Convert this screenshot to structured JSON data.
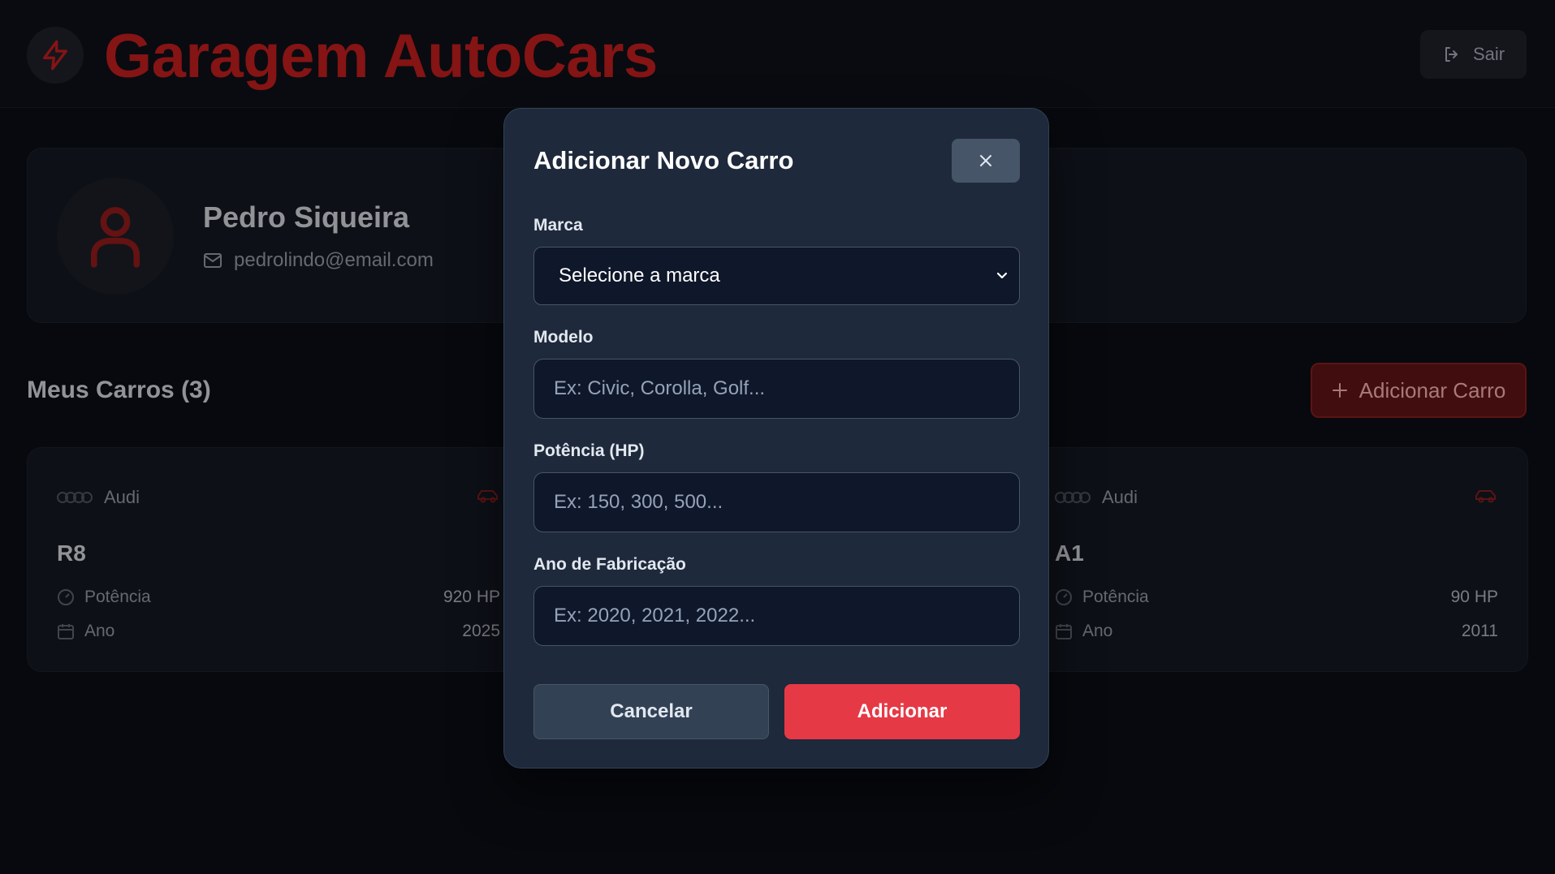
{
  "header": {
    "brand": "Garagem AutoCars",
    "logout_label": "Sair"
  },
  "profile": {
    "name": "Pedro Siqueira",
    "email": "pedrolindo@email.com"
  },
  "cars_section": {
    "title": "Meus Carros (3)",
    "add_button": "Adicionar Carro"
  },
  "cars": [
    {
      "brand": "Audi",
      "model": "R8",
      "power_label": "Potência",
      "power": "920 HP",
      "year_label": "Ano",
      "year": "2025"
    },
    {
      "brand": "Audi",
      "model": "A1",
      "power_label": "Potência",
      "power": "90 HP",
      "year_label": "Ano",
      "year": "2011"
    }
  ],
  "modal": {
    "title": "Adicionar Novo Carro",
    "fields": {
      "brand_label": "Marca",
      "brand_selected": "Selecione a marca",
      "model_label": "Modelo",
      "model_placeholder": "Ex: Civic, Corolla, Golf...",
      "power_label": "Potência (HP)",
      "power_placeholder": "Ex: 150, 300, 500...",
      "year_label": "Ano de Fabricação",
      "year_placeholder": "Ex: 2020, 2021, 2022..."
    },
    "cancel_label": "Cancelar",
    "submit_label": "Adicionar"
  },
  "colors": {
    "accent": "#e63946",
    "modal_bg": "#1e293b",
    "page_bg": "#0a0d14"
  }
}
